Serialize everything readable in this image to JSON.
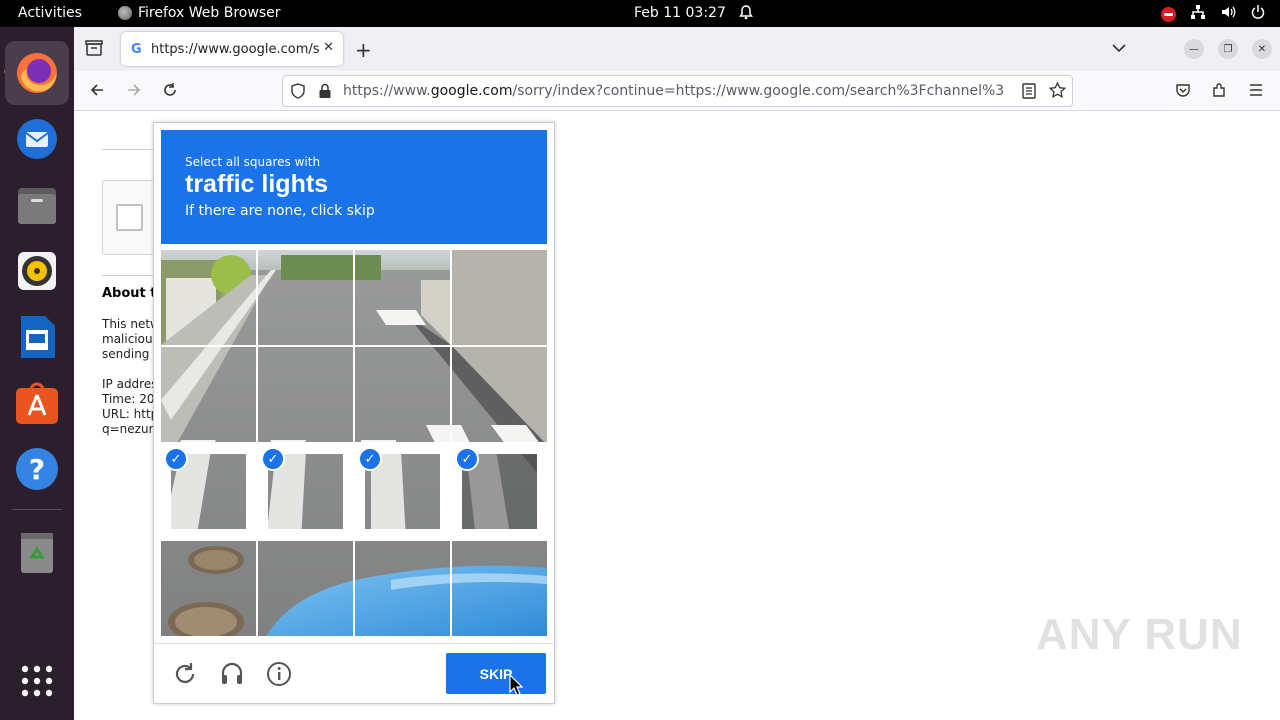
{
  "topbar": {
    "activities": "Activities",
    "app_name": "Firefox Web Browser",
    "clock": "Feb 11  03:27"
  },
  "dock": {
    "items": [
      "firefox-icon",
      "thunderbird-icon",
      "files-icon",
      "rhythmbox-icon",
      "libreoffice-writer-icon",
      "app-center-icon",
      "help-icon",
      "trash-icon",
      "show-apps-icon"
    ]
  },
  "browser": {
    "tab_title": "https://www.google.com/sorry/index",
    "url_prefix": "https://www.",
    "url_host": "google.com",
    "url_rest": "/sorry/index?continue=https://www.google.com/search%3Fchannel%3"
  },
  "page": {
    "about_heading": "About th",
    "para_lines": [
      "This netw",
      "malicious",
      "sending t"
    ],
    "info_lines": [
      "IP addres",
      "Time: 20",
      "URL: http",
      "q=nezur+"
    ]
  },
  "captcha": {
    "instruction_small": "Select all squares with",
    "target": "traffic lights",
    "hint": "If there are none, click skip",
    "skip_label": "SKIP",
    "selected_cells": [
      8,
      9,
      10,
      11
    ],
    "colors": {
      "accent": "#1a73e8"
    }
  },
  "watermark": "ANY RUN"
}
